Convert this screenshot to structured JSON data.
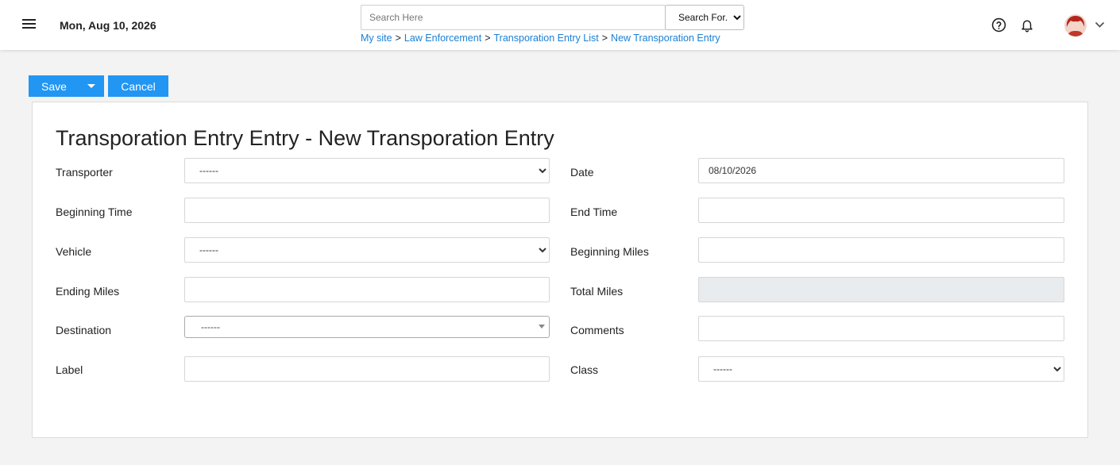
{
  "header": {
    "date": "Mon, Aug 10, 2026",
    "search": {
      "placeholder": "Search Here",
      "value": ""
    },
    "search_for": {
      "selected": "Search For..."
    },
    "breadcrumb": [
      "My site",
      "Law Enforcement",
      "Transporation Entry List",
      "New Transporation Entry"
    ],
    "breadcrumb_separator": ">",
    "icons": [
      "menu-icon",
      "help-icon",
      "bell-icon",
      "avatar",
      "chevron-down-icon"
    ]
  },
  "toolbar": {
    "save_label": "Save",
    "cancel_label": "Cancel"
  },
  "form": {
    "title": "Transporation Entry Entry - New Transporation Entry",
    "left": [
      {
        "label": "Transporter",
        "type": "select",
        "value": "------"
      },
      {
        "label": "Beginning Time",
        "type": "input",
        "value": ""
      },
      {
        "label": "Vehicle",
        "type": "select",
        "value": "------"
      },
      {
        "label": "Ending Miles",
        "type": "input",
        "value": ""
      },
      {
        "label": "Destination",
        "type": "combo",
        "value": "------"
      },
      {
        "label": "Label",
        "type": "input",
        "value": ""
      }
    ],
    "right": [
      {
        "label": "Date",
        "type": "input",
        "value": "08/10/2026"
      },
      {
        "label": "End Time",
        "type": "input",
        "value": ""
      },
      {
        "label": "Beginning Miles",
        "type": "input",
        "value": ""
      },
      {
        "label": "Total Miles",
        "type": "readonly",
        "value": ""
      },
      {
        "label": "Comments",
        "type": "input",
        "value": ""
      },
      {
        "label": "Class",
        "type": "select",
        "value": "------"
      }
    ]
  },
  "colors": {
    "accent": "#2196f3",
    "link": "#1a7fd4",
    "background": "#f3f3f3",
    "readonly": "#e9ecef"
  }
}
